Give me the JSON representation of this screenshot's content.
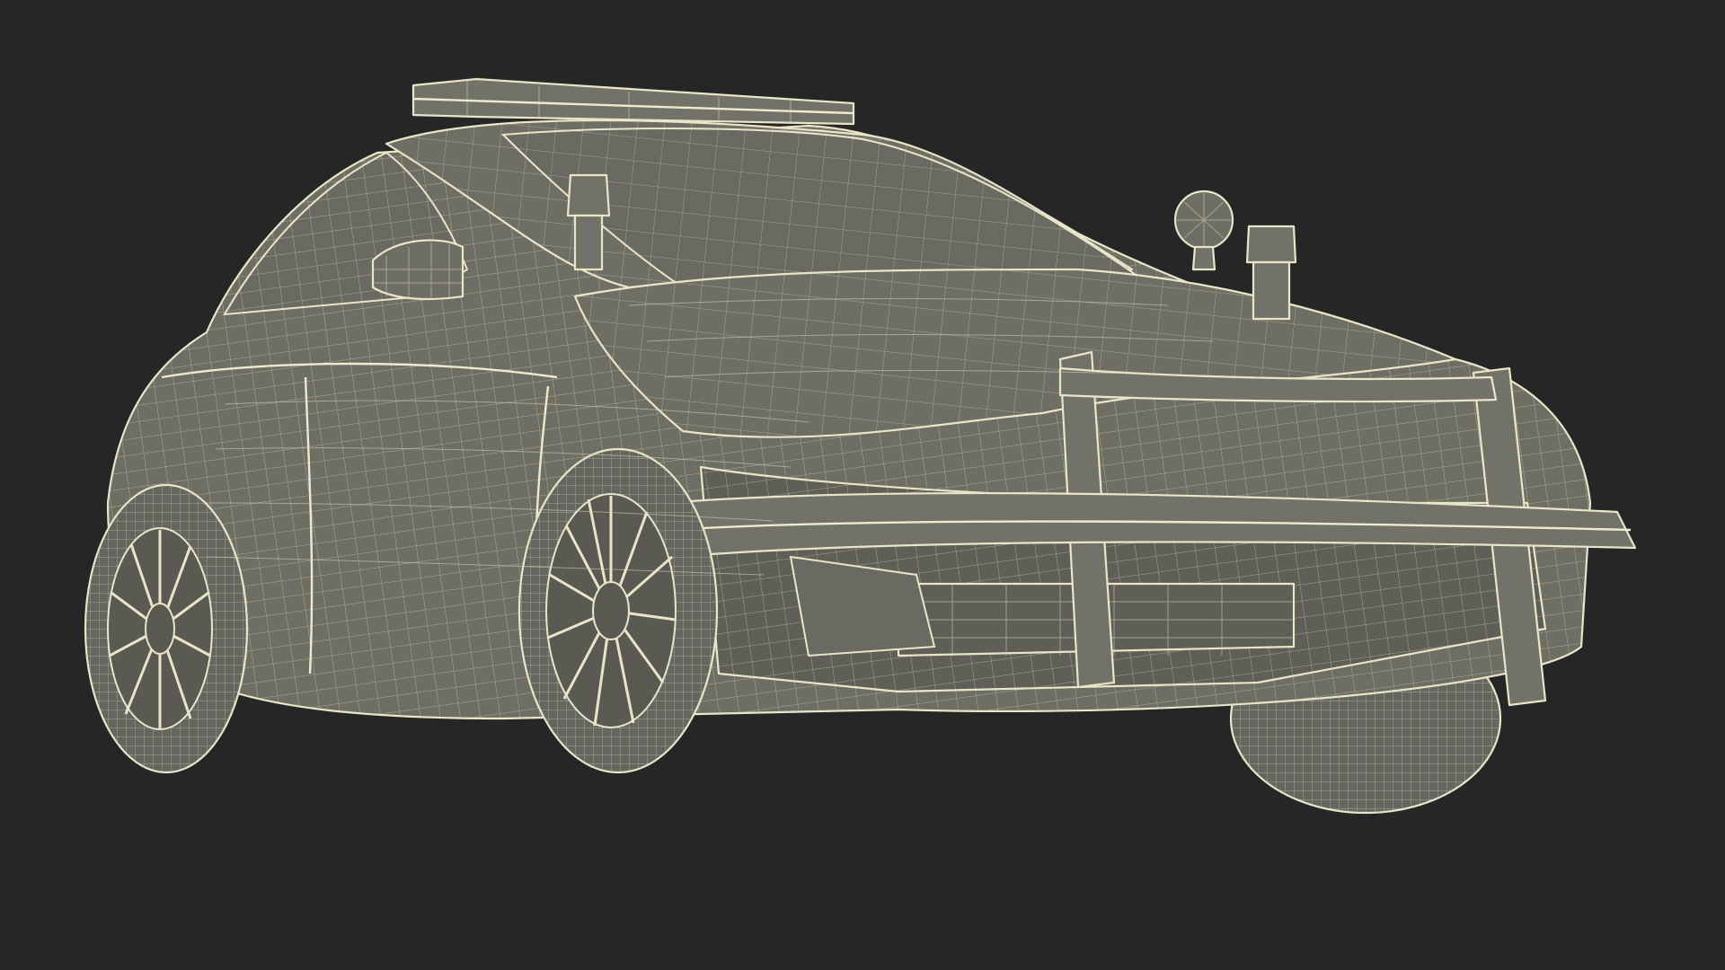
{
  "scene": {
    "background_color": "#262626",
    "wireframe_color": "#e8e6c8",
    "surface_color": "#6e6e64"
  }
}
